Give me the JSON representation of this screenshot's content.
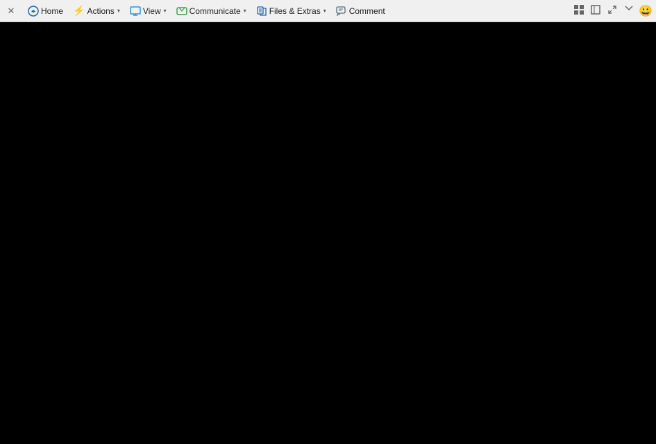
{
  "toolbar": {
    "close_label": "✕",
    "home_label": "Home",
    "actions_label": "Actions",
    "view_label": "View",
    "communicate_label": "Communicate",
    "files_extras_label": "Files & Extras",
    "comment_label": "Comment",
    "icons": {
      "home": "🏠",
      "actions": "⚡",
      "view": "🖥",
      "communicate": "📞",
      "files": "📋",
      "comment": "📝",
      "smiley": "😀"
    }
  },
  "main": {
    "background": "#000000"
  }
}
